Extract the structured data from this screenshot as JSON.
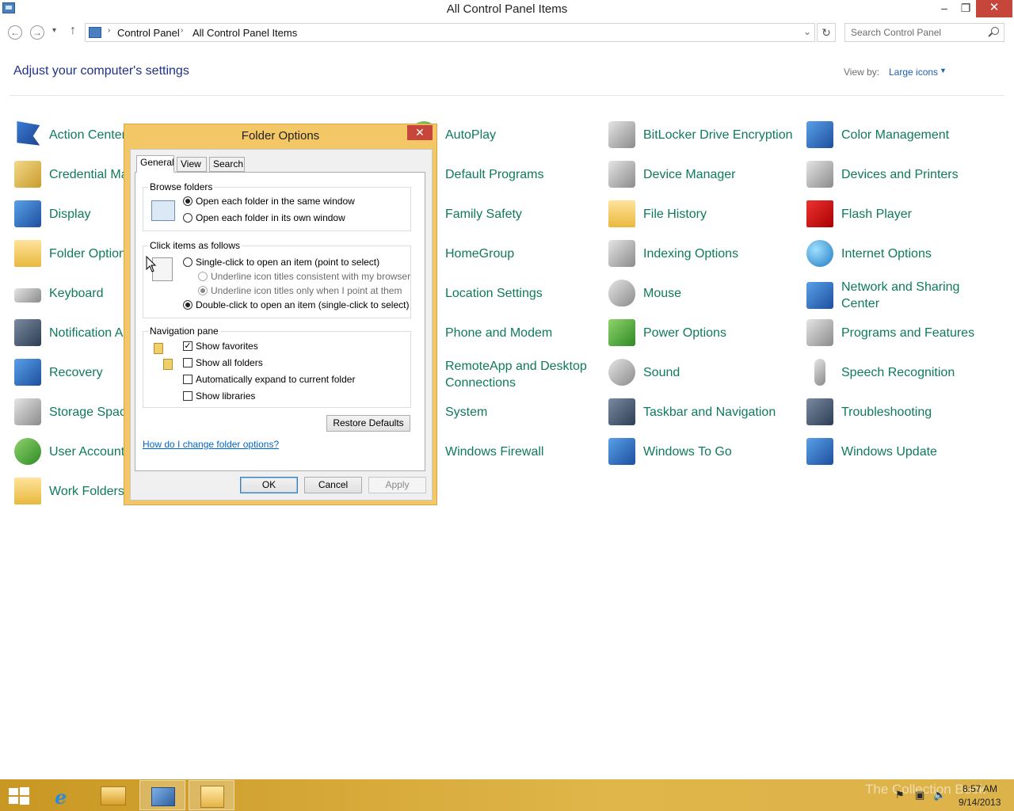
{
  "window": {
    "title": "All Control Panel Items",
    "minimize_glyph": "–",
    "maximize_glyph": "❐",
    "close_glyph": "✕"
  },
  "nav": {
    "back_glyph": "←",
    "forward_glyph": "→",
    "recent_glyph": "▾",
    "up_glyph": "↑",
    "breadcrumb": [
      "Control Panel",
      "All Control Panel Items"
    ],
    "separator": "›",
    "dropdown_glyph": "⌄",
    "refresh_glyph": "↻",
    "search_placeholder": "Search Control Panel"
  },
  "header": {
    "heading": "Adjust your computer's settings",
    "view_by_label": "View by:",
    "view_by_value": "Large icons",
    "view_by_caret": "▼"
  },
  "items": [
    {
      "label": "Action Center",
      "icon": "action-center-flag-icon"
    },
    {
      "label": "Credential Ma",
      "icon": "credential-manager-icon"
    },
    {
      "label": "Display",
      "icon": "display-icon"
    },
    {
      "label": "Folder Option",
      "icon": "folder-options-icon"
    },
    {
      "label": "Keyboard",
      "icon": "keyboard-icon"
    },
    {
      "label": "Notification A",
      "icon": "notification-area-icon"
    },
    {
      "label": "Recovery",
      "icon": "recovery-icon"
    },
    {
      "label": "Storage Space",
      "icon": "storage-spaces-icon"
    },
    {
      "label": "User Accounts",
      "icon": "user-accounts-icon"
    },
    {
      "label": "Work Folders",
      "icon": "work-folders-icon"
    },
    {
      "label": "AutoPlay",
      "icon": "autoplay-icon"
    },
    {
      "label": "Default Programs",
      "icon": "default-programs-icon"
    },
    {
      "label": "Family Safety",
      "icon": "family-safety-icon"
    },
    {
      "label": "HomeGroup",
      "icon": "homegroup-icon"
    },
    {
      "label": "Location Settings",
      "icon": "location-settings-icon"
    },
    {
      "label": "Phone and Modem",
      "icon": "phone-modem-icon"
    },
    {
      "label": "RemoteApp and Desktop Connections",
      "icon": "remoteapp-icon"
    },
    {
      "label": "System",
      "icon": "system-icon"
    },
    {
      "label": "Windows Firewall",
      "icon": "windows-firewall-icon"
    },
    {
      "label": "BitLocker Drive Encryption",
      "icon": "bitlocker-icon"
    },
    {
      "label": "Device Manager",
      "icon": "device-manager-icon"
    },
    {
      "label": "File History",
      "icon": "file-history-icon"
    },
    {
      "label": "Indexing Options",
      "icon": "indexing-options-icon"
    },
    {
      "label": "Mouse",
      "icon": "mouse-icon"
    },
    {
      "label": "Power Options",
      "icon": "power-options-icon"
    },
    {
      "label": "Sound",
      "icon": "sound-icon"
    },
    {
      "label": "Taskbar and Navigation",
      "icon": "taskbar-navigation-icon"
    },
    {
      "label": "Windows To Go",
      "icon": "windows-to-go-icon"
    },
    {
      "label": "Color Management",
      "icon": "color-management-icon"
    },
    {
      "label": "Devices and Printers",
      "icon": "devices-printers-icon"
    },
    {
      "label": "Flash Player",
      "icon": "flash-player-icon"
    },
    {
      "label": "Internet Options",
      "icon": "internet-options-icon"
    },
    {
      "label": "Network and Sharing Center",
      "icon": "network-sharing-icon"
    },
    {
      "label": "Programs and Features",
      "icon": "programs-features-icon"
    },
    {
      "label": "Speech Recognition",
      "icon": "speech-recognition-icon"
    },
    {
      "label": "Troubleshooting",
      "icon": "troubleshooting-icon"
    },
    {
      "label": "Windows Update",
      "icon": "windows-update-icon"
    }
  ],
  "dialog": {
    "title": "Folder Options",
    "close_glyph": "✕",
    "tabs": [
      "General",
      "View",
      "Search"
    ],
    "active_tab": "General",
    "browse_folders": {
      "title": "Browse folders",
      "options": [
        {
          "label": "Open each folder in the same window",
          "checked": true
        },
        {
          "label": "Open each folder in its own window",
          "checked": false
        }
      ]
    },
    "click_items": {
      "title": "Click items as follows",
      "single_click": {
        "label": "Single-click to open an item (point to select)",
        "checked": false
      },
      "underline_browser": {
        "label": "Underline icon titles consistent with my browser",
        "checked": false
      },
      "underline_point": {
        "label": "Underline icon titles only when I point at them",
        "checked": true
      },
      "double_click": {
        "label": "Double-click to open an item (single-click to select)",
        "checked": true
      }
    },
    "navigation_pane": {
      "title": "Navigation pane",
      "options": [
        {
          "label": "Show favorites",
          "checked": true
        },
        {
          "label": "Show all folders",
          "checked": false
        },
        {
          "label": "Automatically expand to current folder",
          "checked": false
        },
        {
          "label": "Show libraries",
          "checked": false
        }
      ]
    },
    "check_glyph": "✓",
    "restore_defaults": "Restore Defaults",
    "help_link": "How do I change folder options?",
    "ok": "OK",
    "cancel": "Cancel",
    "apply": "Apply"
  },
  "taskbar": {
    "watermark": "The Collection Book",
    "ie_glyph": "e",
    "tray": {
      "flag": "⚑",
      "network": "▣",
      "volume": "🔈"
    },
    "time": "8:57 AM",
    "date": "9/14/2013"
  }
}
